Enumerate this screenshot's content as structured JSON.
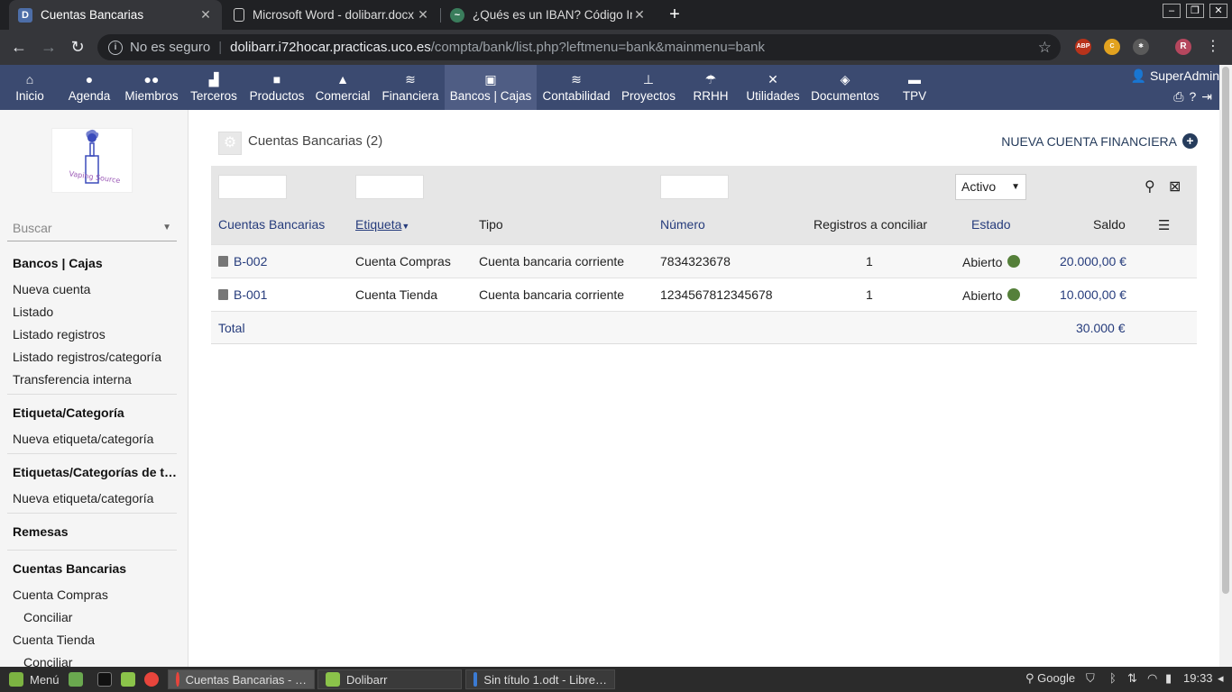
{
  "browser": {
    "tabs": [
      {
        "title": "Cuentas Bancarias",
        "active": true
      },
      {
        "title": "Microsoft Word - dolibarr.docx",
        "active": false
      },
      {
        "title": "¿Qués es un IBAN? Código Inter",
        "active": false
      }
    ],
    "security_label": "No es seguro",
    "url_host": "dolibarr.i72hocar.practicas.uco.es",
    "url_path": "/compta/bank/list.php?leftmenu=bank&mainmenu=bank"
  },
  "topmenu": {
    "items": [
      "Inicio",
      "Agenda",
      "Miembros",
      "Terceros",
      "Productos",
      "Comercial",
      "Financiera",
      "Bancos | Cajas",
      "Contabilidad",
      "Proyectos",
      "RRHH",
      "Utilidades",
      "Documentos",
      "TPV"
    ],
    "active": "Bancos | Cajas",
    "user": "SuperAdmin"
  },
  "leftmenu": {
    "search_placeholder": "Buscar",
    "logo_text": "Vaping Source",
    "bank_header": "Bancos | Cajas",
    "bank_items": [
      "Nueva cuenta",
      "Listado",
      "Listado registros",
      "Listado registros/categoría",
      "Transferencia interna"
    ],
    "tag_header": "Etiqueta/Categoría",
    "tag_items": [
      "Nueva etiqueta/categoría"
    ],
    "tags2_header": "Etiquetas/Categorías de t…",
    "tags2_items": [
      "Nueva etiqueta/categoría"
    ],
    "remesas_header": "Remesas",
    "accounts_header": "Cuentas Bancarias",
    "accounts": [
      {
        "name": "Cuenta Compras",
        "action": "Conciliar"
      },
      {
        "name": "Cuenta Tienda",
        "action": "Conciliar"
      }
    ]
  },
  "page": {
    "title": "Cuentas Bancarias (2)",
    "new_button": "NUEVA CUENTA FINANCIERA",
    "status_filter": "Activo",
    "columns": [
      "Cuentas Bancarias",
      "Etiqueta",
      "Tipo",
      "Número",
      "Registros a conciliar",
      "Estado",
      "Saldo"
    ],
    "rows": [
      {
        "ref": "B-002",
        "label": "Cuenta Compras",
        "type": "Cuenta bancaria corriente",
        "number": "7834323678",
        "to_reconcile": "1",
        "status": "Abierto",
        "balance": "20.000,00 €"
      },
      {
        "ref": "B-001",
        "label": "Cuenta Tienda",
        "type": "Cuenta bancaria corriente",
        "number": "1234567812345678",
        "to_reconcile": "1",
        "status": "Abierto",
        "balance": "10.000,00 €"
      }
    ],
    "total_label": "Total",
    "total_value": "30.000 €"
  },
  "taskbar": {
    "menu": "Menú",
    "windows": [
      "Cuentas Bancarias - …",
      "Dolibarr",
      "Sin título 1.odt - Libre…"
    ],
    "search": "Google",
    "clock": "19:33"
  },
  "colors": {
    "topmenu_bg": "#3b4a70",
    "link": "#263c7c",
    "status_open": "#55803a"
  }
}
